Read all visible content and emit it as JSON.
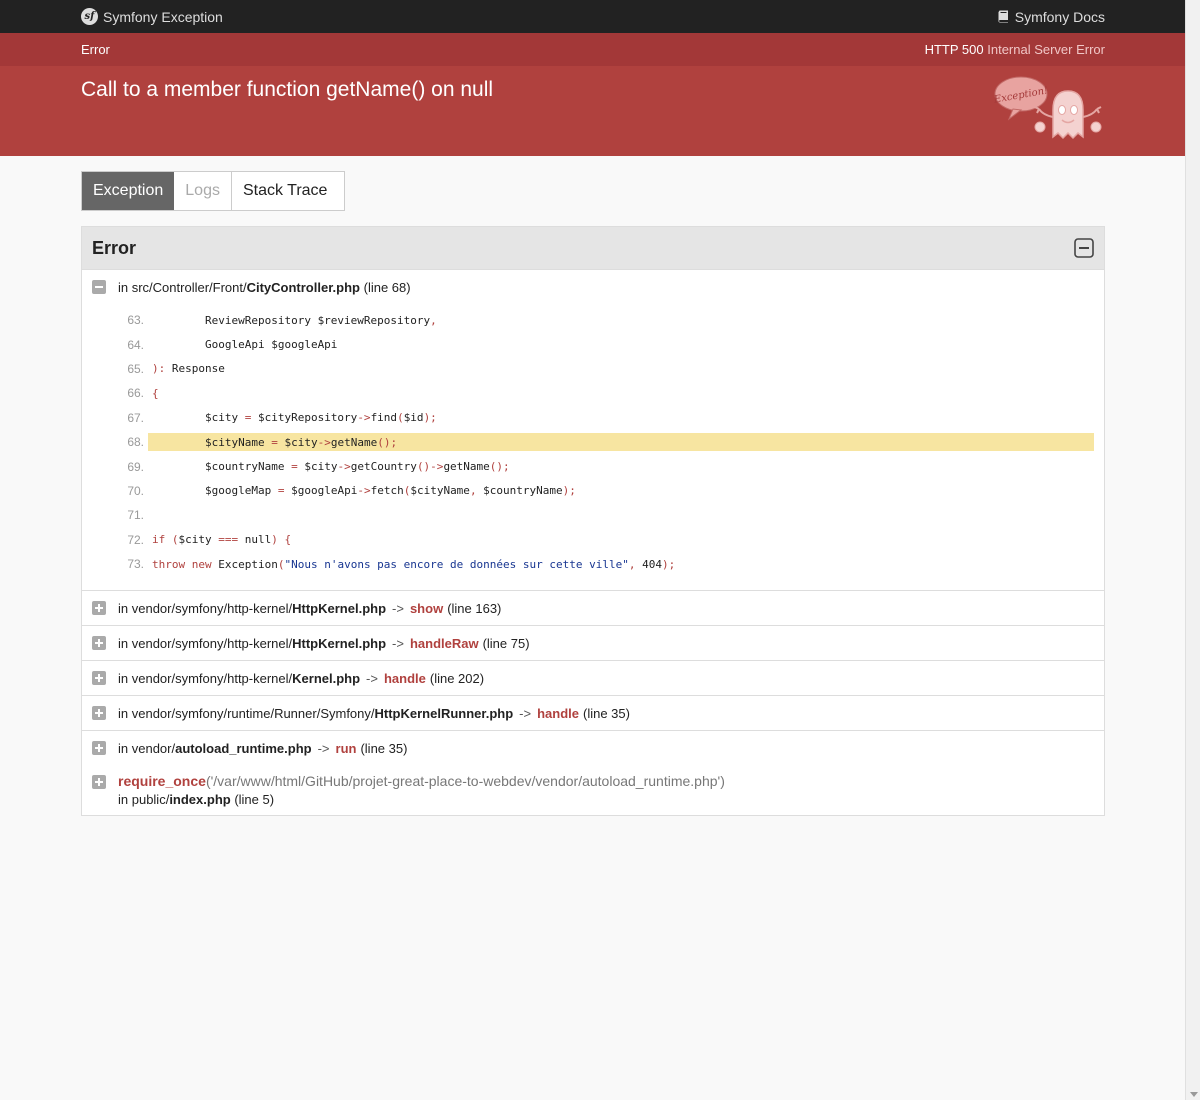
{
  "topbar": {
    "brand": "Symfony Exception",
    "docs": "Symfony Docs"
  },
  "status": {
    "label": "Error",
    "code": "HTTP 500",
    "text": "Internal Server Error"
  },
  "exception": {
    "message": "Call to a member function getName() on null",
    "mascot_text": "Exception!"
  },
  "tabs": [
    {
      "label": "Exception",
      "state": "active"
    },
    {
      "label": "Logs",
      "state": "disabled"
    },
    {
      "label": "Stack Trace",
      "state": "normal"
    }
  ],
  "panel": {
    "title": "Error"
  },
  "first_trace": {
    "prefix": "in src/Controller/Front/",
    "file": "CityController.php",
    "line": "(line 68)"
  },
  "code": [
    {
      "n": "63.",
      "html": "        ReviewRepository $reviewRepository<span class='k'>,</span>"
    },
    {
      "n": "64.",
      "html": "        GoogleApi $googleApi"
    },
    {
      "n": "65.",
      "html": "        <span class='k'>):</span> Response"
    },
    {
      "n": "66.",
      "html": "    <span class='k'>{</span>"
    },
    {
      "n": "67.",
      "html": "        $city <span class='k'>=</span> $cityRepository<span class='k'>-></span>find<span class='k'>(</span>$id<span class='k'>);</span>"
    },
    {
      "n": "68.",
      "html": "        $cityName <span class='k'>=</span> $city<span class='k'>-></span>getName<span class='k'>();</span>",
      "hl": true
    },
    {
      "n": "69.",
      "html": "        $countryName <span class='k'>=</span> $city<span class='k'>-></span>getCountry<span class='k'>()-></span>getName<span class='k'>();</span>"
    },
    {
      "n": "70.",
      "html": "        $googleMap <span class='k'>=</span> $googleApi<span class='k'>-></span>fetch<span class='k'>(</span>$cityName<span class='k'>,</span> $countryName<span class='k'>);</span>"
    },
    {
      "n": "71.",
      "html": ""
    },
    {
      "n": "72.",
      "html": "        <span class='k'>if (</span>$city <span class='k'>===</span> null<span class='k'>) {</span>"
    },
    {
      "n": "73.",
      "html": "            <span class='k'>throw new</span> Exception<span class='k'>(</span><span class='s'>\"Nous n'avons pas encore de données sur cette ville\"</span><span class='k'>,</span> 404<span class='k'>);</span>"
    }
  ],
  "trace": [
    {
      "prefix": "in vendor/symfony/http-kernel/",
      "file": "HttpKernel.php",
      "method": "show",
      "line": "(line 163)"
    },
    {
      "prefix": "in vendor/symfony/http-kernel/",
      "file": "HttpKernel.php",
      "method": "handleRaw",
      "line": "(line 75)"
    },
    {
      "prefix": "in vendor/symfony/http-kernel/",
      "file": "Kernel.php",
      "method": "handle",
      "line": "(line 202)"
    },
    {
      "prefix": "in vendor/symfony/runtime/Runner/Symfony/",
      "file": "HttpKernelRunner.php",
      "method": "handle",
      "line": "(line 35)"
    },
    {
      "prefix": "in vendor/",
      "file": "autoload_runtime.php",
      "method": "run",
      "line": "(line 35)"
    }
  ],
  "arrow": "->",
  "last_trace": {
    "func": "require_once",
    "arg": "('/var/www/html/GitHub/projet-great-place-to-webdev/vendor/autoload_runtime.php')",
    "prefix": "in public/",
    "file": "index.php",
    "line": "(line 5)"
  }
}
